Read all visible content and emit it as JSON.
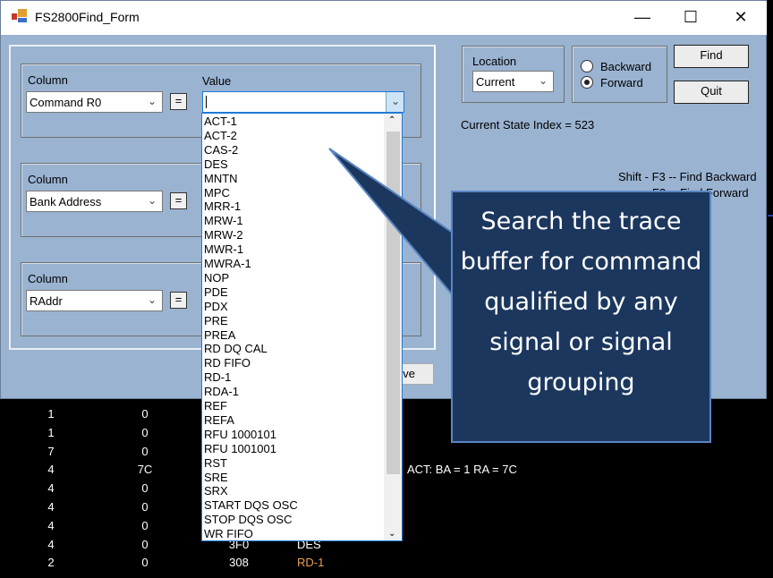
{
  "window": {
    "title": "FS2800Find_Form",
    "minimize": "—",
    "maximize": "☐",
    "close": "✕"
  },
  "criteria": [
    {
      "column_label": "Column",
      "column_value": "Command R0",
      "operator": "=",
      "value_label": "Value",
      "value": ""
    },
    {
      "column_label": "Column",
      "column_value": "Bank Address",
      "operator": "="
    },
    {
      "column_label": "Column",
      "column_value": "RAddr",
      "operator": "="
    }
  ],
  "value_options": [
    "ACT-1",
    "ACT-2",
    "CAS-2",
    "DES",
    "MNTN",
    "MPC",
    "MRR-1",
    "MRW-1",
    "MRW-2",
    "MWR-1",
    "MWRA-1",
    "NOP",
    "PDE",
    "PDX",
    "PRE",
    "PREA",
    "RD DQ CAL",
    "RD FIFO",
    "RD-1",
    "RDA-1",
    "REF",
    "REFA",
    "RFU 1000101",
    "RFU 1001001",
    "RST",
    "SRE",
    "SRX",
    "START DQS OSC",
    "STOP DQS OSC",
    "WR FIFO"
  ],
  "location": {
    "label": "Location",
    "value": "Current"
  },
  "direction": {
    "options": [
      {
        "label": "Backward",
        "selected": false
      },
      {
        "label": "Forward",
        "selected": true
      }
    ]
  },
  "buttons": {
    "find": "Find",
    "quit": "Quit",
    "partial": "ve"
  },
  "state_index": "Current State Index = 523",
  "shortcuts": [
    "Shift - F3 -- Find Backward",
    "F3 -- Find Forward"
  ],
  "trace_rows": [
    {
      "c1": "1",
      "c2": "0",
      "c3": "",
      "c4": ""
    },
    {
      "c1": "1",
      "c2": "0",
      "c3": "",
      "c4": ""
    },
    {
      "c1": "7",
      "c2": "0",
      "c3": "",
      "c4": ""
    },
    {
      "c1": "4",
      "c2": "7C",
      "c3": "",
      "c4": "",
      "note": "ACT: BA = 1 RA = 7C"
    },
    {
      "c1": "4",
      "c2": "0",
      "c3": "",
      "c4": ""
    },
    {
      "c1": "4",
      "c2": "0",
      "c3": "",
      "c4": ""
    },
    {
      "c1": "4",
      "c2": "0",
      "c3": "",
      "c4": ""
    },
    {
      "c1": "4",
      "c2": "0",
      "c3": "3F0",
      "c4": "DES"
    },
    {
      "c1": "2",
      "c2": "0",
      "c3": "308",
      "c4": "RD-1",
      "c4_color": "#e8a050"
    }
  ],
  "callout": {
    "text": "Search the trace buffer for command qualified by any signal or signal grouping"
  },
  "colors": {
    "form_bg": "#9ab3d1",
    "callout_bg": "#1c375e",
    "highlight": "#e8a050"
  }
}
